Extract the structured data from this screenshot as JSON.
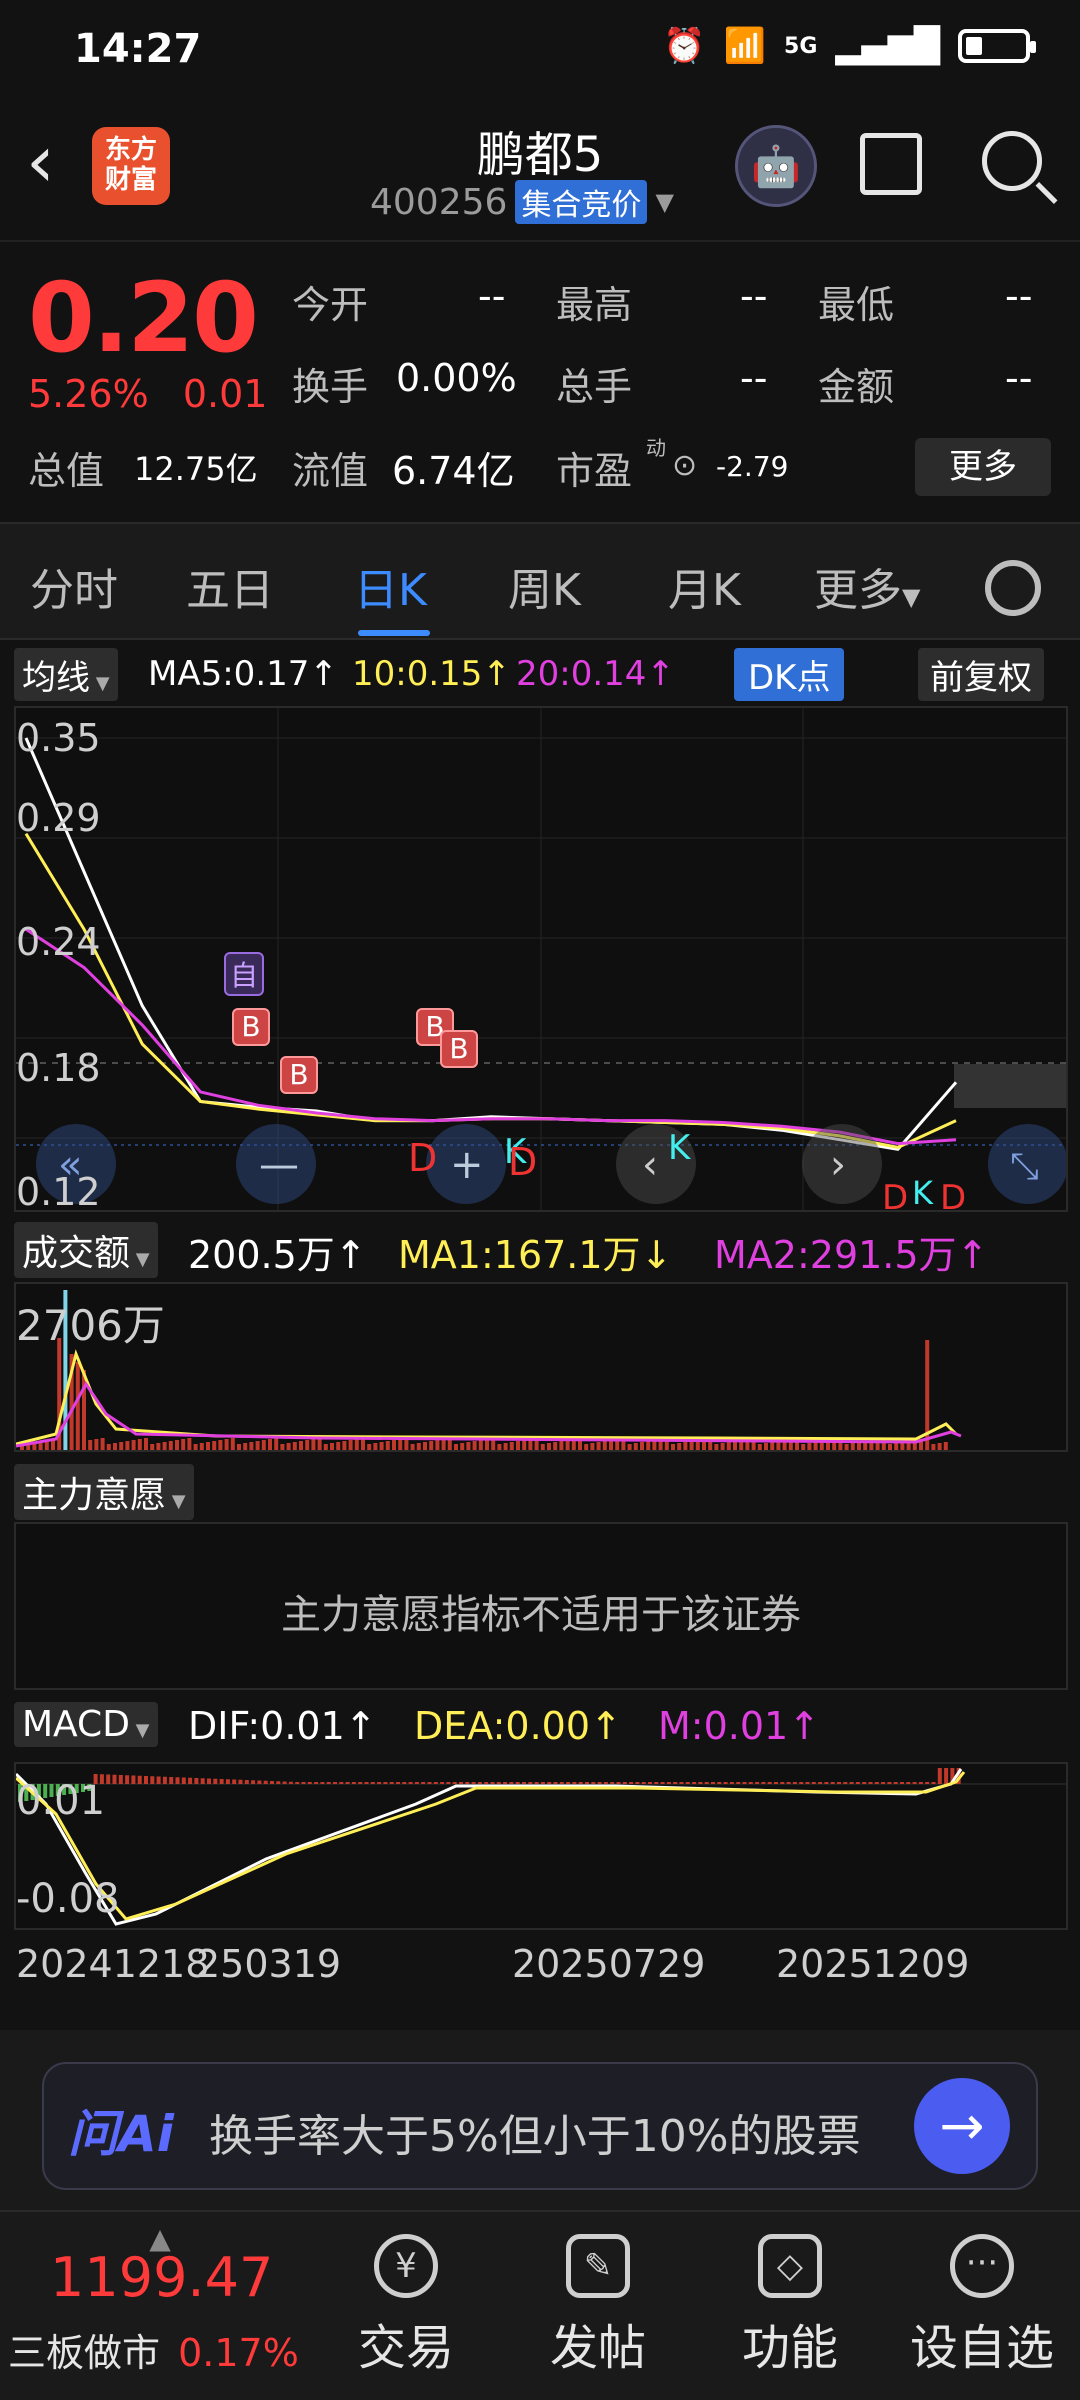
{
  "status_bar": {
    "time": "14:27",
    "network": "5G"
  },
  "header": {
    "logo_text_line1": "东方",
    "logo_text_line2": "财富",
    "stock_name": "鹏都5",
    "stock_code": "400256",
    "auction_badge": "集合竞价"
  },
  "quote": {
    "price": "0.20",
    "change_pct": "5.26%",
    "change_amt": "0.01",
    "open_label": "今开",
    "open_value": "--",
    "high_label": "最高",
    "high_value": "--",
    "low_label": "最低",
    "low_value": "--",
    "turnover_label": "换手",
    "turnover_value": "0.00%",
    "volume_label": "总手",
    "volume_value": "--",
    "amount_label": "金额",
    "amount_value": "--",
    "mktcap_label": "总值",
    "mktcap_value": "12.75亿",
    "float_label": "流值",
    "float_value": "6.74亿",
    "pe_label": "市盈",
    "pe_superscript": "动",
    "pe_value": "-2.79",
    "more_button": "更多"
  },
  "tabs": [
    "分时",
    "五日",
    "日K",
    "周K",
    "月K",
    "更多"
  ],
  "active_tab": "日K",
  "ma_row": {
    "selector": "均线",
    "ma5": "MA5:0.17↑",
    "ma10": "10:0.15↑",
    "ma20": "20:0.14↑",
    "dk_button": "DK点",
    "adjust_button": "前复权"
  },
  "kline_axis": {
    "labels": [
      "0.35",
      "0.29",
      "0.24",
      "0.18",
      "0.12"
    ]
  },
  "kline_markers": {
    "zi": "自",
    "b": "B",
    "d": "D",
    "k": "K"
  },
  "volume_row": {
    "selector": "成交额",
    "value": "200.5万↑",
    "ma1": "MA1:167.1万↓",
    "ma2": "MA2:291.5万↑",
    "axis_max": "2706万"
  },
  "intent_row": {
    "selector": "主力意愿",
    "message": "主力意愿指标不适用于该证券"
  },
  "macd_row": {
    "selector": "MACD",
    "dif": "DIF:0.01↑",
    "dea": "DEA:0.00↑",
    "m": "M:0.01↑",
    "axis_top": "0.01",
    "axis_bottom": "-0.08"
  },
  "date_axis": [
    "20241218",
    "250319",
    "20250729",
    "20251209"
  ],
  "ai_bar": {
    "logo": "问Ai",
    "prompt": "换手率大于5%但小于10%的股票"
  },
  "bottom_nav": {
    "index_value": "1199.47",
    "index_name": "三板做市",
    "index_change": "0.17%",
    "items": [
      "交易",
      "发帖",
      "功能",
      "设自选"
    ]
  },
  "colors": {
    "up": "#ff3a3a",
    "accent": "#3d8cff",
    "ma5": "#ffffff",
    "ma10": "#ffee55",
    "ma20": "#e040e0"
  },
  "chart_data": {
    "type": "line",
    "ylim": [
      0.12,
      0.35
    ],
    "series": [
      {
        "name": "MA5",
        "values": [
          0.35,
          0.28,
          0.21,
          0.16,
          0.157,
          0.155,
          0.15,
          0.15,
          0.152,
          0.151,
          0.15,
          0.149,
          0.148,
          0.145,
          0.14,
          0.135,
          0.17
        ]
      },
      {
        "name": "MA10",
        "values": [
          0.3,
          0.25,
          0.19,
          0.16,
          0.156,
          0.153,
          0.15,
          0.15,
          0.151,
          0.151,
          0.15,
          0.149,
          0.148,
          0.146,
          0.142,
          0.136,
          0.15
        ]
      },
      {
        "name": "MA20",
        "values": [
          0.25,
          0.23,
          0.2,
          0.165,
          0.158,
          0.154,
          0.151,
          0.15,
          0.151,
          0.151,
          0.15,
          0.15,
          0.149,
          0.147,
          0.144,
          0.138,
          0.14
        ]
      }
    ]
  }
}
